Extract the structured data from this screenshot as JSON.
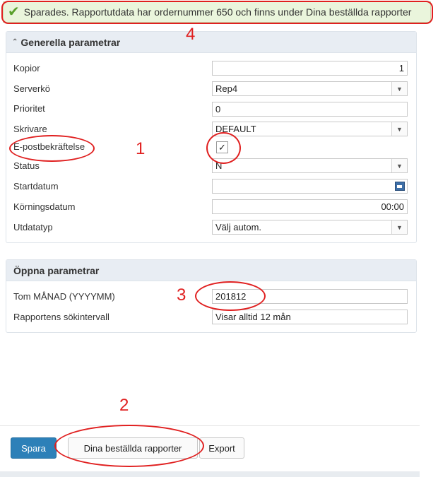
{
  "banner": {
    "message": "Sparades. Rapportutdata har ordernummer 650 och finns under Dina beställda rapporter"
  },
  "general": {
    "title": "Generella parametrar",
    "fields": {
      "kopior": {
        "label": "Kopior",
        "value": "1"
      },
      "serverko": {
        "label": "Serverkö",
        "value": "Rep4"
      },
      "prioritet": {
        "label": "Prioritet",
        "value": "0"
      },
      "skrivare": {
        "label": "Skrivare",
        "value": "DEFAULT"
      },
      "epost": {
        "label": "E-postbekräftelse",
        "checked": true,
        "mark": "✓"
      },
      "status": {
        "label": "Status",
        "value": "N"
      },
      "startdatum": {
        "label": "Startdatum",
        "value": ""
      },
      "korningsdatum": {
        "label": "Körningsdatum",
        "value": "00:00"
      },
      "utdatatyp": {
        "label": "Utdatatyp",
        "value": "Välj autom."
      }
    }
  },
  "open": {
    "title": "Öppna parametrar",
    "fields": {
      "tom_manad": {
        "label": "Tom MÅNAD (YYYYMM)",
        "value": "201812"
      },
      "sokintervall": {
        "label": "Rapportens sökintervall",
        "value": "Visar alltid 12 mån"
      }
    }
  },
  "footer": {
    "save": "Spara",
    "ordered_reports": "Dina beställda rapporter",
    "export": "Export"
  },
  "annotations": [
    "1",
    "2",
    "3",
    "4"
  ],
  "colors": {
    "annotation": "#e02020",
    "primary_button": "#2d80b8",
    "banner_bg": "#eaf5dc"
  }
}
